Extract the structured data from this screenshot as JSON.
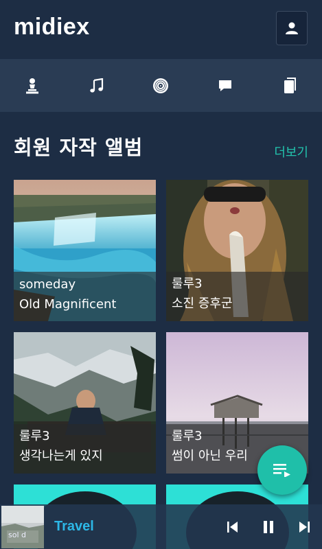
{
  "app": {
    "logo": "midiex"
  },
  "header": {
    "profile_icon": "user-icon"
  },
  "nav": {
    "items": [
      {
        "icon": "chess-pawn-icon"
      },
      {
        "icon": "music-note-icon"
      },
      {
        "icon": "vinyl-disc-icon"
      },
      {
        "icon": "chat-bubble-icon"
      },
      {
        "icon": "notebook-icon"
      }
    ]
  },
  "section": {
    "title": "회원 자작 앨범",
    "more_label": "더보기"
  },
  "albums": [
    {
      "artist": "someday",
      "title": "Old Magnificent"
    },
    {
      "artist": "룰루3",
      "title": "소진 증후군"
    },
    {
      "artist": "룰루3",
      "title": "생각나는게 있지"
    },
    {
      "artist": "룰루3",
      "title": "썸이 아닌 우리"
    }
  ],
  "player": {
    "track": "Travel",
    "thumb_text": "sol d"
  },
  "colors": {
    "accent": "#22c3ad",
    "track_title": "#2db7e6",
    "background": "#1d2d44",
    "nav_bg": "#2a3c54",
    "fab": "#1fbfa9"
  }
}
